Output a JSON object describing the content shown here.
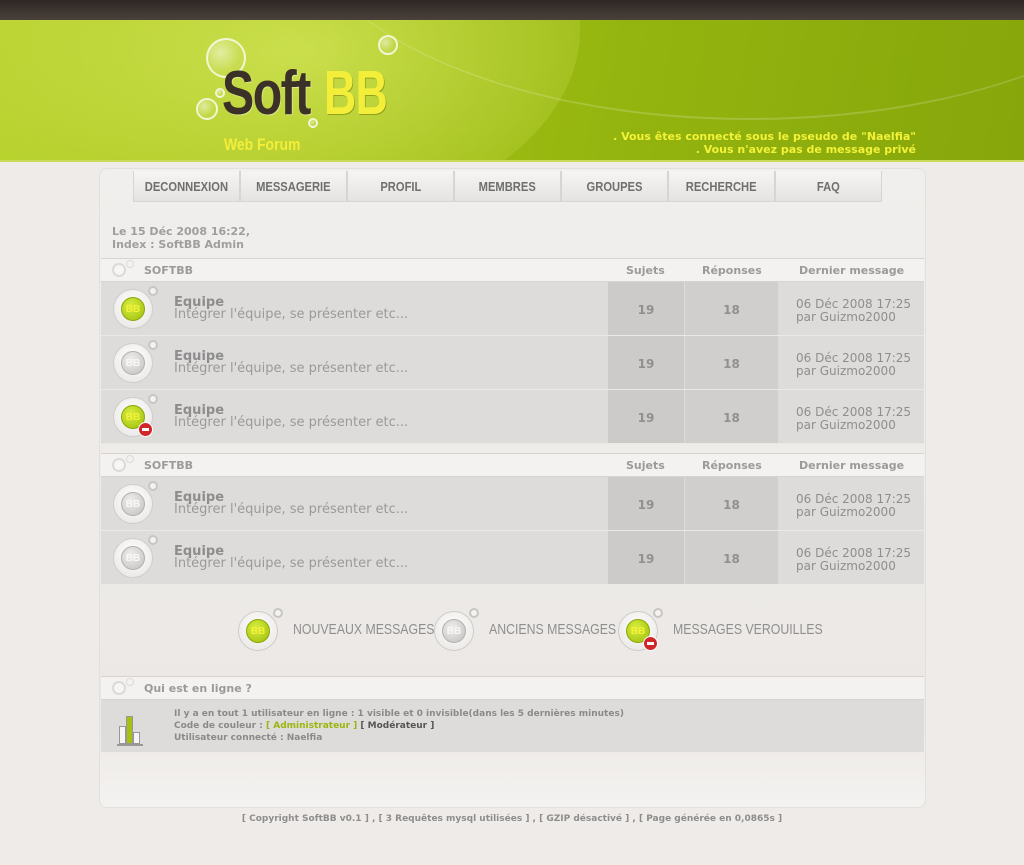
{
  "header": {
    "logo_soft": "Soft",
    "logo_bb": "BB",
    "logo_sub": "Web Forum",
    "msg_line1": ". Vous êtes connecté sous le pseudo de \"Naelfia\"",
    "msg_line2": ". Vous n'avez pas de message privé"
  },
  "nav": [
    "DECONNEXION",
    "MESSAGERIE",
    "PROFIL",
    "MEMBRES",
    "GROUPES",
    "RECHERCHE",
    "FAQ"
  ],
  "date_line": "Le 15 Déc 2008 16:22,",
  "index_line": "Index : SoftBB Admin",
  "tables": [
    {
      "category": "SOFTBB",
      "col_topics": "Sujets",
      "col_replies": "Réponses",
      "col_last": "Dernier message",
      "rows": [
        {
          "icon": "new",
          "title": "Equipe",
          "desc": "Intégrer l'équipe, se présenter etc...",
          "topics": "19",
          "replies": "18",
          "last_date": "06 Déc 2008 17:25",
          "last_by": "par Guizmo2000"
        },
        {
          "icon": "old",
          "title": "Equipe",
          "desc": "Intégrer l'équipe, se présenter etc...",
          "topics": "19",
          "replies": "18",
          "last_date": "06 Déc 2008 17:25",
          "last_by": "par Guizmo2000"
        },
        {
          "icon": "locked",
          "title": "Equipe",
          "desc": "Intégrer l'équipe, se présenter etc...",
          "topics": "19",
          "replies": "18",
          "last_date": "06 Déc 2008 17:25",
          "last_by": "par Guizmo2000"
        }
      ]
    },
    {
      "category": "SOFTBB",
      "col_topics": "Sujets",
      "col_replies": "Réponses",
      "col_last": "Dernier message",
      "rows": [
        {
          "icon": "old",
          "title": "Equipe",
          "desc": "Intégrer l'équipe, se présenter etc...",
          "topics": "19",
          "replies": "18",
          "last_date": "06 Déc 2008 17:25",
          "last_by": "par Guizmo2000"
        },
        {
          "icon": "old",
          "title": "Equipe",
          "desc": "Intégrer l'équipe, se présenter etc...",
          "topics": "19",
          "replies": "18",
          "last_date": "06 Déc 2008 17:25",
          "last_by": "par Guizmo2000"
        }
      ]
    }
  ],
  "icon_text": "BB",
  "legend": {
    "new": "NOUVEAUX MESSAGES",
    "old": "ANCIENS MESSAGES",
    "locked": "MESSAGES VEROUILLES"
  },
  "online": {
    "title": "Qui est en ligne ?",
    "line1": "Il y a en tout 1 utilisateur en ligne : 1 visible et 0 invisible(dans les 5 dernières minutes)",
    "color_label": "Code de couleur :",
    "admin": "[ Administrateur ]",
    "moderator": "[ Modérateur ]",
    "connected": "Utilisateur connecté : Naelfia"
  },
  "footer": "[ Copyright SoftBB v0.1 ] , [ 3 Requêtes mysql utilisées ] , [ GZIP désactivé ] , [ Page générée en 0,0865s ]",
  "colors": {
    "brand_green": "#a8c317",
    "brand_yellow": "#f3ee3a",
    "locked_red": "#d0262a"
  }
}
